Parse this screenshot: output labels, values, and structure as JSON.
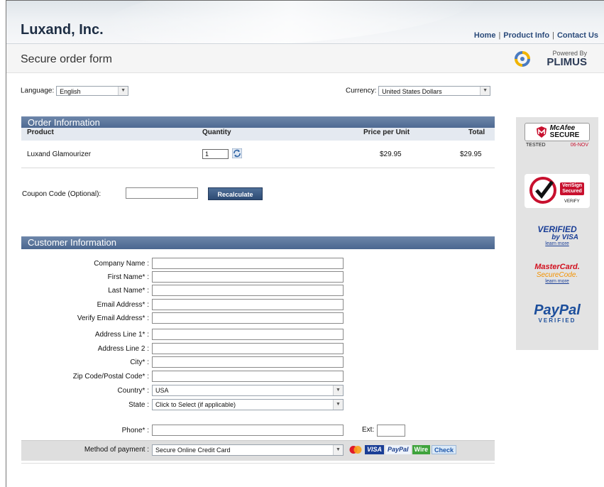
{
  "header": {
    "company": "Luxand, Inc.",
    "links": [
      "Home",
      "Product Info",
      "Contact Us"
    ],
    "separator": "|"
  },
  "subheader": {
    "title": "Secure order form",
    "powered_by": "Powered By",
    "plimus": "PLIMUS"
  },
  "language": {
    "label": "Language:",
    "value": "English"
  },
  "currency": {
    "label": "Currency:",
    "value": "United States Dollars"
  },
  "order": {
    "title": "Order Information",
    "columns": [
      "Product",
      "Quantity",
      "Price per Unit",
      "Total"
    ],
    "row": {
      "product": "Luxand Glamourizer",
      "quantity": "1",
      "price": "$29.95",
      "total": "$29.95"
    }
  },
  "coupon": {
    "label": "Coupon Code (Optional):",
    "button": "Recalculate"
  },
  "customer": {
    "title": "Customer Information",
    "fields": [
      "Company Name :",
      "First Name* :",
      "Last Name* :",
      "Email Address* :",
      "Verify Email Address* :",
      "Address Line 1* :",
      "Address Line 2 :",
      "City* :",
      "Zip Code/Postal Code* :",
      "Country* :",
      "State :",
      "Phone* :"
    ],
    "country_value": "USA",
    "state_value": "Click to Select (if applicable)",
    "ext_label": "Ext:"
  },
  "payment": {
    "label": "Method of payment :",
    "value": "Secure Online Credit Card",
    "options": [
      "VISA",
      "PayPal",
      "Wire",
      "Check"
    ]
  },
  "trust": {
    "mcafee": {
      "name": "McAfee",
      "sub": "SECURE",
      "tested": "TESTED",
      "date": "06-NOV"
    },
    "verisign": {
      "line1": "VeriSign",
      "line2": "Secured",
      "line3": "VERIFY"
    },
    "visa": {
      "line1": "VERIFIED",
      "line2": "by VISA",
      "line3": "learn more"
    },
    "mastercard": {
      "line1": "MasterCard.",
      "line2": "SecureCode.",
      "line3": "learn more"
    },
    "paypal": {
      "line1": "PayPal",
      "line2": "VERIFIED"
    }
  },
  "colors": {
    "section_bar": "#4a668f",
    "link": "#2a4a7a",
    "trust_bg": "#e3e3e3"
  }
}
